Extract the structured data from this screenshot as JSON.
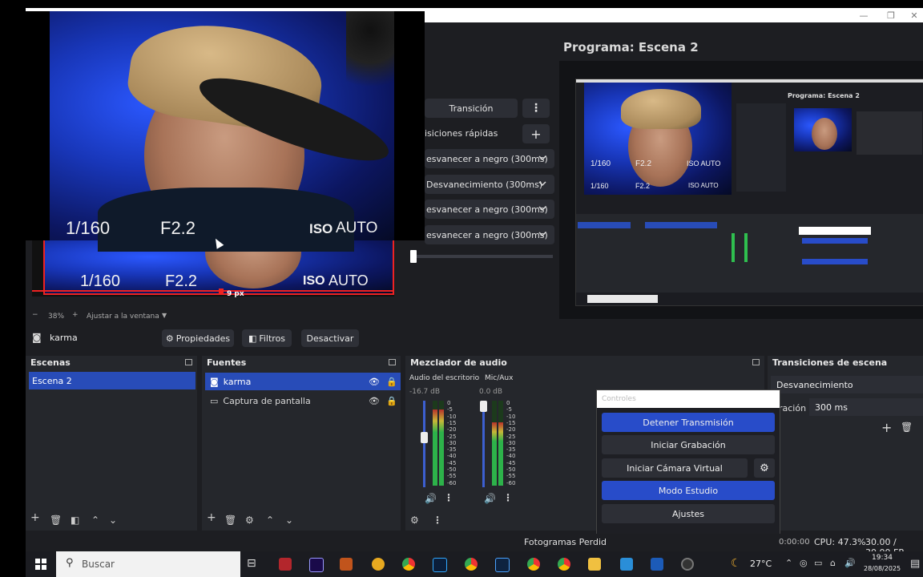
{
  "window": {
    "minimize": "—",
    "maximize": "❐",
    "close": "✕"
  },
  "preview_overlay": {
    "shutter": "1/160",
    "aperture": "F2.2",
    "iso_label": "ISO",
    "iso_value": "AUTO"
  },
  "preview_bottom": {
    "shutter": "1/160",
    "aperture": "F2.2",
    "iso_label": "ISO",
    "iso_value": "AUTO",
    "px_label": "9 px"
  },
  "zoom_bar": {
    "minus": "−",
    "zoom": "38%",
    "plus": "+",
    "fit": "Ajustar a la ventana"
  },
  "transitions_col": {
    "transition_label": "Transición",
    "quick_label": "isiciones rápidas",
    "items": [
      "esvanecer a negro (300ms)",
      "Desvanecimiento (300ms)",
      "esvanecer a negro (300ms)",
      "esvanecer a negro (300ms)"
    ]
  },
  "program": {
    "title": "Programa: Escena 2"
  },
  "nested": {
    "title": "Programa: Escena 2",
    "cam": [
      "1/160",
      "F2.2",
      "ISO AUTO"
    ]
  },
  "source_toolbar": {
    "source": "karma",
    "props": "Propiedades",
    "filters": "Filtros",
    "deactivate": "Desactivar"
  },
  "scenes": {
    "title": "Escenas",
    "items": [
      "Escena 2"
    ]
  },
  "sources": {
    "title": "Fuentes",
    "items": [
      {
        "name": "karma",
        "icon": "camera-icon"
      },
      {
        "name": "Captura de pantalla",
        "icon": "monitor-icon"
      }
    ]
  },
  "mixer": {
    "title": "Mezclador de audio",
    "channels": [
      {
        "name": "Audio del escritorio",
        "db": "-16.7 dB",
        "fader": 0.58,
        "level": 0.9
      },
      {
        "name": "Mic/Aux",
        "db": "0.0 dB",
        "fader": 1.0,
        "level": 0.75
      }
    ],
    "ticks": [
      "0",
      "-5",
      "-10",
      "-15",
      "-20",
      "-25",
      "-30",
      "-35",
      "-40",
      "-45",
      "-50",
      "-55",
      "-60"
    ]
  },
  "scene_transitions": {
    "title": "Transiciones de escena",
    "select": "Desvanecimiento",
    "duration_label": "ración",
    "duration": "300 ms"
  },
  "controls": {
    "title": "Controles",
    "stop_stream": "Detener Transmisión",
    "start_record": "Iniciar Grabación",
    "virtual_cam": "Iniciar Cámara Virtual",
    "studio": "Modo Estudio",
    "settings": "Ajustes"
  },
  "status": {
    "dropped": "Fotogramas Perdid",
    "time": "0:00:00",
    "cpu": "CPU: 47.3%",
    "fps": "30.00 / 30.00 FP"
  },
  "taskbar": {
    "search": "Buscar",
    "weather": "27°C",
    "time": "19:34",
    "date": "28/08/2025"
  },
  "colors": {
    "accent": "#284cc9",
    "selection": "#284cb8",
    "dock": "#25272c",
    "bg": "#1d1e22"
  }
}
